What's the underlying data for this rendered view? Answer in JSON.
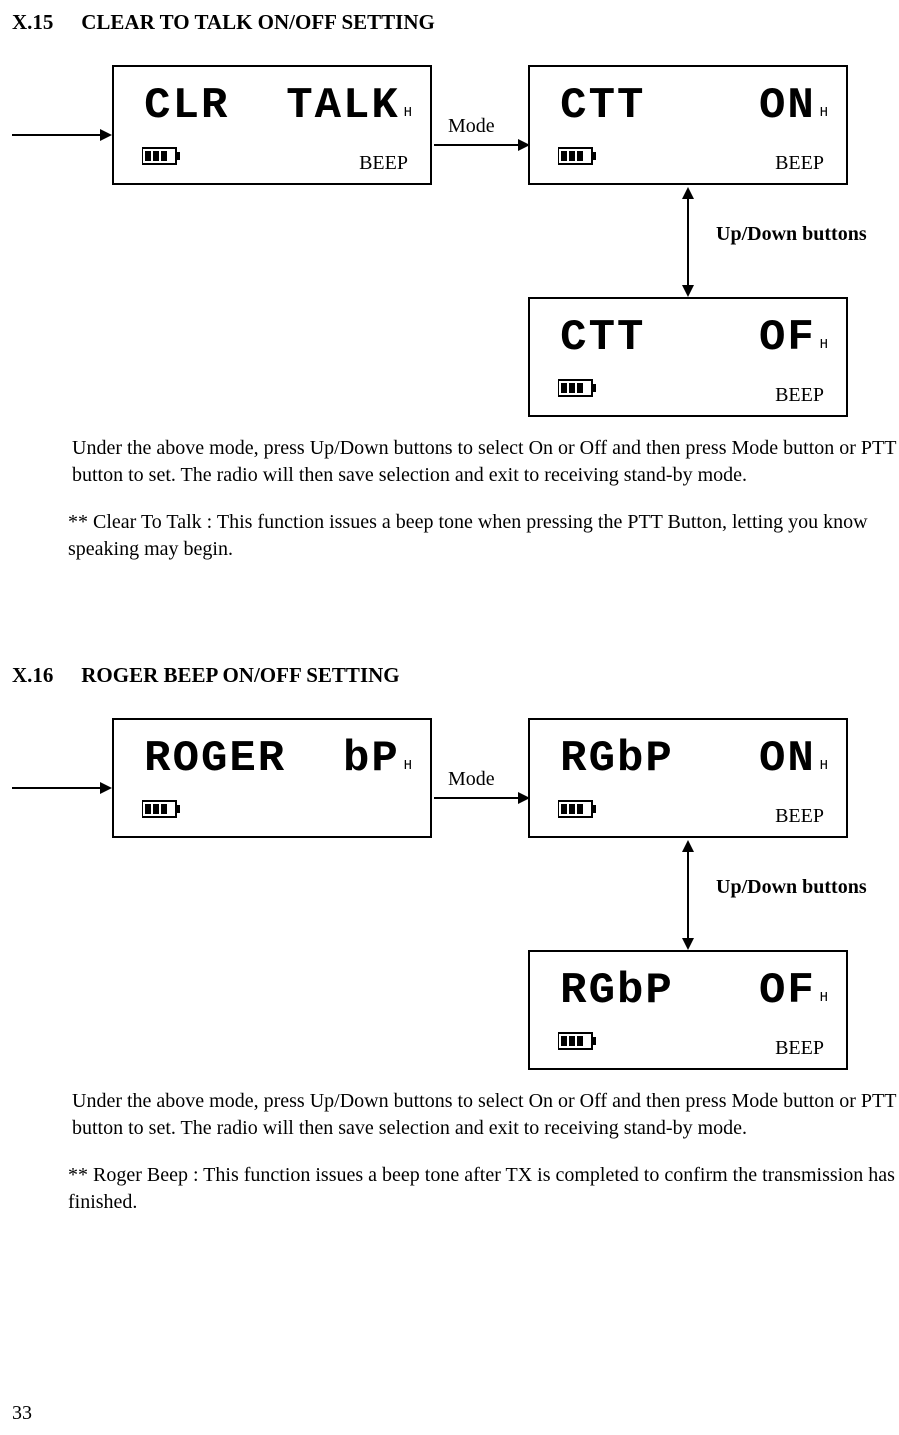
{
  "page_number": "33",
  "sections": {
    "x15": {
      "number": "X.15",
      "title": "CLEAR TO TALK ON/OFF SETTING",
      "lcd_entry": "CLR  TALK",
      "lcd_on": "CTT    ON",
      "lcd_off": "CTT    OF",
      "h": "H",
      "beep": "BEEP",
      "mode_label": "Mode",
      "updown_label": "Up/Down buttons",
      "para1": "Under the above mode, press Up/Down buttons to select On or Off and then press Mode button or PTT button to set. The radio will then save selection and exit to receiving stand-by mode.",
      "note": "** Clear To Talk : This function issues a beep tone when pressing the PTT Button, letting you know speaking may begin."
    },
    "x16": {
      "number": "X.16",
      "title": "ROGER BEEP ON/OFF SETTING",
      "lcd_entry": "ROGER  bP",
      "lcd_on": "RGbP   ON",
      "lcd_off": "RGbP   OF",
      "h": "H",
      "beep": "BEEP",
      "mode_label": "Mode",
      "updown_label": "Up/Down buttons",
      "para1": "Under the above mode, press Up/Down buttons to select On or Off and then press Mode button or PTT button to set. The radio will then save selection and exit to receiving stand-by mode.",
      "note": "** Roger Beep : This function issues a beep tone after  TX is completed to confirm the transmission has finished."
    }
  }
}
